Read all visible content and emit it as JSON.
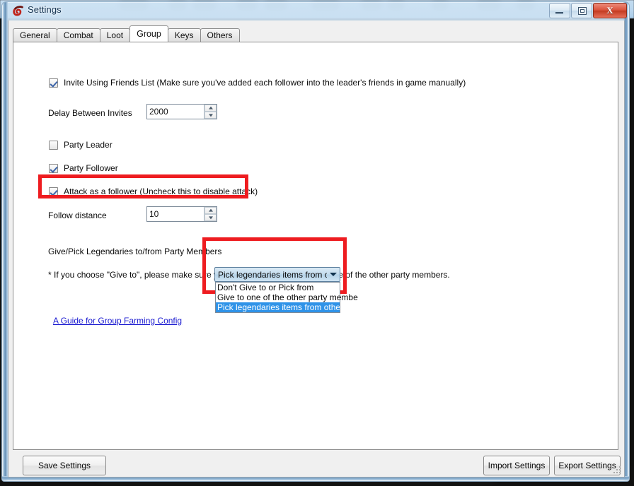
{
  "window": {
    "title": "Settings",
    "app_icon": "swirl-icon",
    "controls": {
      "minimize": "minimize-icon",
      "maximize": "maximize-icon",
      "close": "X"
    }
  },
  "tabs": [
    {
      "label": "General",
      "selected": false
    },
    {
      "label": "Combat",
      "selected": false
    },
    {
      "label": "Loot",
      "selected": false
    },
    {
      "label": "Group",
      "selected": true
    },
    {
      "label": "Keys",
      "selected": false
    },
    {
      "label": "Others",
      "selected": false
    }
  ],
  "group_tab": {
    "invite_friends": {
      "label": "Invite Using Friends List (Make sure you've added each follower into the leader's friends in game manually)",
      "checked": true
    },
    "delay_between_invites": {
      "label": "Delay Between Invites",
      "value": "2000"
    },
    "party_leader": {
      "label": "Party Leader",
      "checked": false
    },
    "party_follower": {
      "label": "Party Follower",
      "checked": true
    },
    "attack_as_follower": {
      "label": "Attack as a follower (Uncheck this to disable attack)",
      "checked": true,
      "highlighted": true
    },
    "follow_distance": {
      "label": "Follow distance",
      "value": "10"
    },
    "legendaries": {
      "label": "Give/Pick Legendaries to/from Party Members",
      "selected_value": "Pick legendaries items from othe",
      "expanded": true,
      "options": [
        {
          "label": "Don't Give to or Pick from",
          "selected": false
        },
        {
          "label": "Give to one of the other party membe",
          "selected": false
        },
        {
          "label": "Pick legendaries items from other par",
          "selected": true
        }
      ]
    },
    "note_prefix": "* If you choose \"Give to\", please make sure you",
    "note_suffix": "one of the other party members.",
    "guide_link": "A Guide for Group Farming Config"
  },
  "footer": {
    "save_settings": "Save Settings",
    "import_settings": "Import Settings",
    "export_settings": "Export Settings"
  },
  "colors": {
    "highlight_red": "#ee1c20",
    "selection_blue": "#2f93e8",
    "link_blue": "#1a1ad0"
  }
}
